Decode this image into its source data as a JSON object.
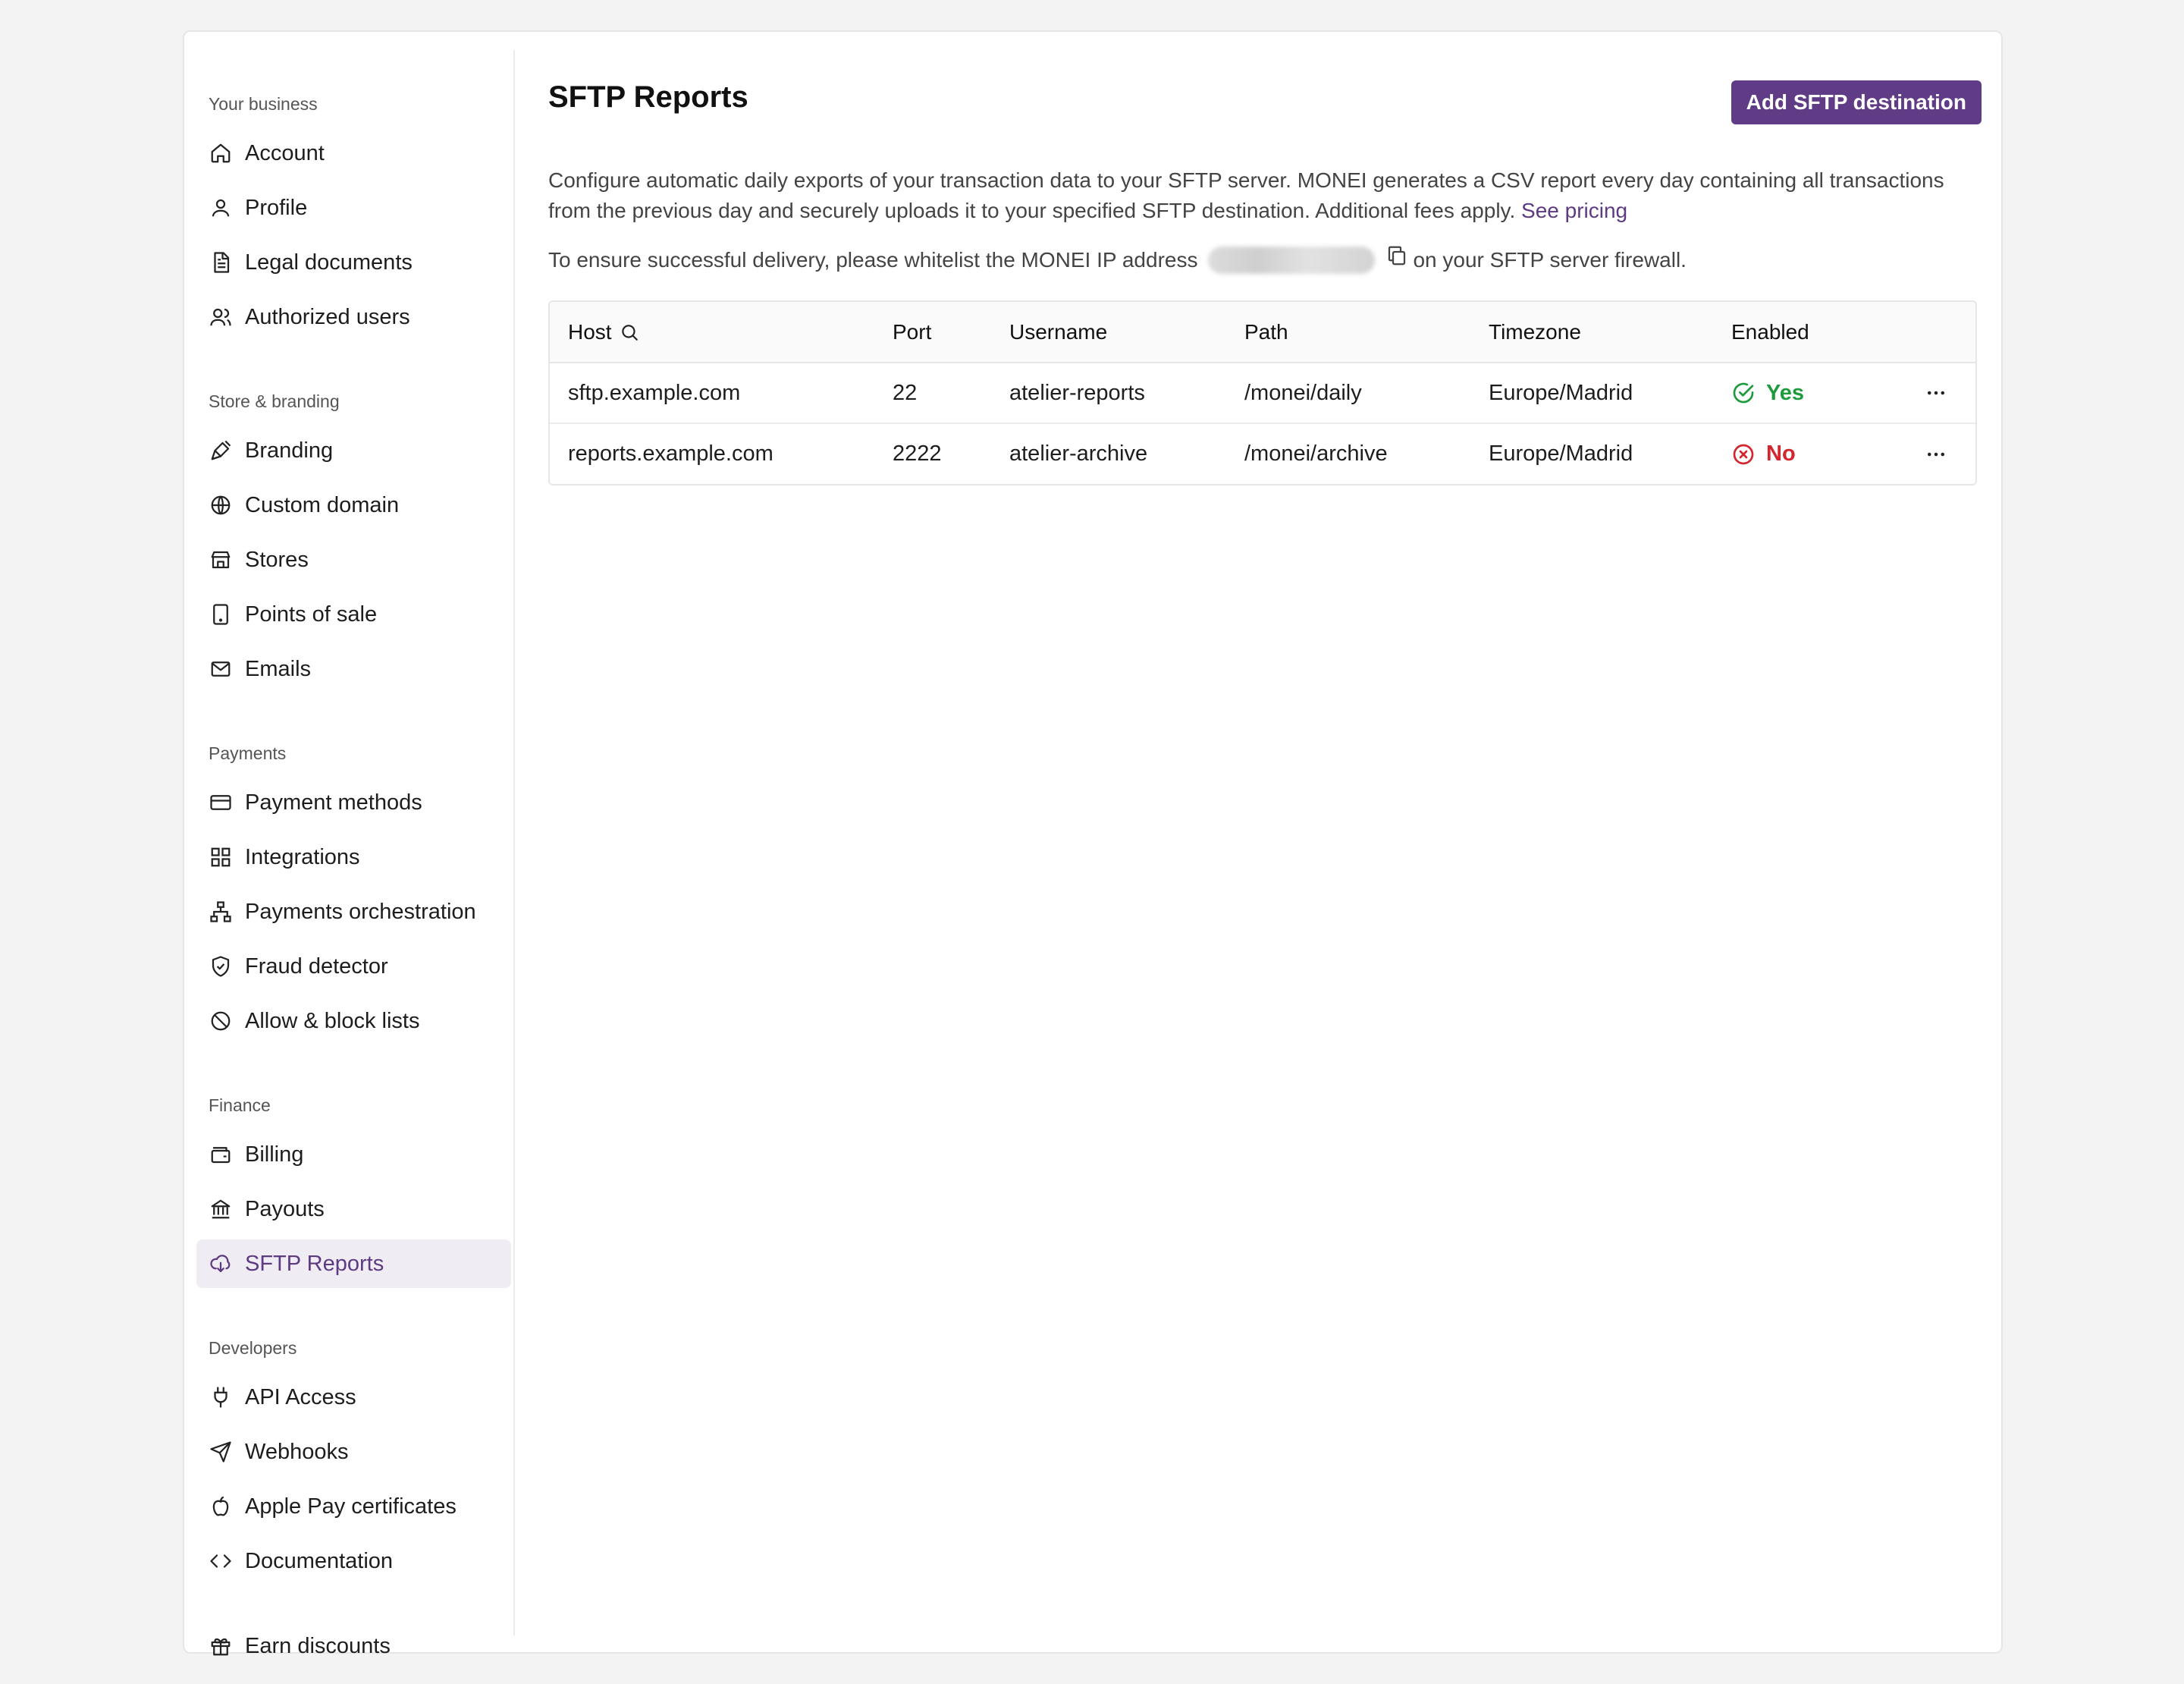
{
  "sidebar": {
    "sections": [
      {
        "title": "Your business",
        "items": [
          {
            "label": "Account",
            "icon": "home-icon"
          },
          {
            "label": "Profile",
            "icon": "user-icon"
          },
          {
            "label": "Legal documents",
            "icon": "document-icon"
          },
          {
            "label": "Authorized users",
            "icon": "users-icon"
          }
        ]
      },
      {
        "title": "Store & branding",
        "items": [
          {
            "label": "Branding",
            "icon": "paintbrush-icon"
          },
          {
            "label": "Custom domain",
            "icon": "globe-icon"
          },
          {
            "label": "Stores",
            "icon": "store-icon"
          },
          {
            "label": "Points of sale",
            "icon": "tablet-icon"
          },
          {
            "label": "Emails",
            "icon": "mail-icon"
          }
        ]
      },
      {
        "title": "Payments",
        "items": [
          {
            "label": "Payment methods",
            "icon": "credit-card-icon"
          },
          {
            "label": "Integrations",
            "icon": "grid-icon"
          },
          {
            "label": "Payments orchestration",
            "icon": "network-icon"
          },
          {
            "label": "Fraud detector",
            "icon": "shield-check-icon"
          },
          {
            "label": "Allow & block lists",
            "icon": "ban-icon"
          }
        ]
      },
      {
        "title": "Finance",
        "items": [
          {
            "label": "Billing",
            "icon": "wallet-icon"
          },
          {
            "label": "Payouts",
            "icon": "bank-icon"
          },
          {
            "label": "SFTP Reports",
            "icon": "cloud-download-icon",
            "active": true
          }
        ]
      },
      {
        "title": "Developers",
        "items": [
          {
            "label": "API Access",
            "icon": "plug-icon"
          },
          {
            "label": "Webhooks",
            "icon": "send-icon"
          },
          {
            "label": "Apple Pay certificates",
            "icon": "apple-icon"
          },
          {
            "label": "Documentation",
            "icon": "code-icon"
          }
        ]
      }
    ],
    "footer_item": {
      "label": "Earn discounts",
      "icon": "gift-icon"
    }
  },
  "main": {
    "title": "SFTP Reports",
    "add_button": "Add SFTP destination",
    "description": "Configure automatic daily exports of your transaction data to your SFTP server. MONEI generates a CSV report every day containing all transactions from the previous day and securely uploads it to your specified SFTP destination. Additional fees apply.",
    "pricing_link": "See pricing",
    "ip_prefix": "To ensure successful delivery, please whitelist the MONEI IP address",
    "ip_suffix": "on your SFTP server firewall.",
    "table": {
      "headers": [
        "Host",
        "Port",
        "Username",
        "Path",
        "Timezone",
        "Enabled"
      ],
      "rows": [
        {
          "host": "sftp.example.com",
          "port": "22",
          "username": "atelier-reports",
          "path": "/monei/daily",
          "timezone": "Europe/Madrid",
          "enabled": "Yes",
          "enabled_state": true
        },
        {
          "host": "reports.example.com",
          "port": "2222",
          "username": "atelier-archive",
          "path": "/monei/archive",
          "timezone": "Europe/Madrid",
          "enabled": "No",
          "enabled_state": false
        }
      ]
    }
  },
  "colors": {
    "accent": "#603c86",
    "active_bg": "#efedf3",
    "success": "#1f9a3d",
    "danger": "#d3262f"
  }
}
